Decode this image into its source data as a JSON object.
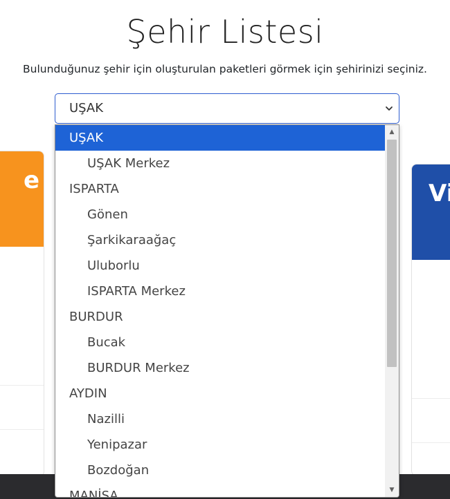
{
  "page": {
    "title": "Şehir Listesi",
    "subtitle": "Bulunduğunuz şehir için oluşturulan paketleri görmek için şehirinizi seçiniz."
  },
  "cards": {
    "left_head_text": "e",
    "left_color": "#f7931e",
    "right_head_text": "Vi",
    "right_color": "#1f4fa8"
  },
  "select": {
    "value": "UŞAK",
    "border_color": "#2d5ccf",
    "icon": "chevron-down-icon"
  },
  "dropdown": {
    "selected_color": "#1e63d6",
    "options": [
      {
        "label": "UŞAK",
        "level": "group",
        "selected": true
      },
      {
        "label": "UŞAK Merkez",
        "level": "child",
        "selected": false
      },
      {
        "label": "ISPARTA",
        "level": "group",
        "selected": false
      },
      {
        "label": "Gönen",
        "level": "child",
        "selected": false
      },
      {
        "label": "Şarkikaraağaç",
        "level": "child",
        "selected": false
      },
      {
        "label": "Uluborlu",
        "level": "child",
        "selected": false
      },
      {
        "label": "ISPARTA Merkez",
        "level": "child",
        "selected": false
      },
      {
        "label": "BURDUR",
        "level": "group",
        "selected": false
      },
      {
        "label": "Bucak",
        "level": "child",
        "selected": false
      },
      {
        "label": "BURDUR Merkez",
        "level": "child",
        "selected": false
      },
      {
        "label": "AYDIN",
        "level": "group",
        "selected": false
      },
      {
        "label": "Nazilli",
        "level": "child",
        "selected": false
      },
      {
        "label": "Yenipazar",
        "level": "child",
        "selected": false
      },
      {
        "label": "Bozdoğan",
        "level": "child",
        "selected": false
      },
      {
        "label": "MANİSA",
        "level": "group",
        "selected": false
      }
    ],
    "scroll_up_glyph": "▲",
    "scroll_down_glyph": "▼"
  },
  "footer": {
    "color": "#2b2b2e"
  }
}
